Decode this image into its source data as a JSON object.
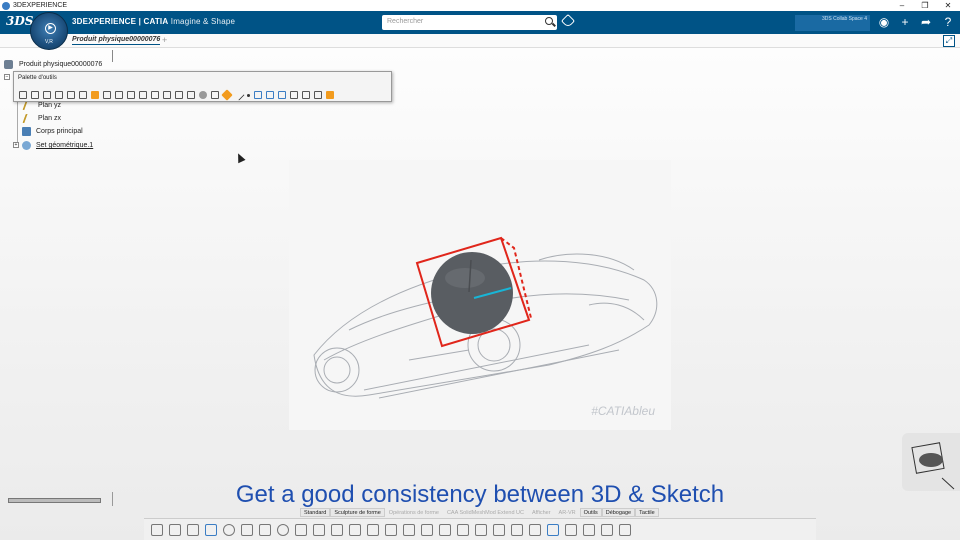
{
  "window": {
    "title": "3DEXPERIENCE",
    "controls": [
      "–",
      "❐",
      "✕"
    ]
  },
  "header": {
    "brand": "3DEXPERIENCE | CATIA",
    "app_name": "Imagine & Shape",
    "compass_version": "V,R",
    "search_placeholder": "Rechercher",
    "user_line1": "",
    "user_line2": "3DS Collab Space 4"
  },
  "tabs": {
    "active": "Produit physique00000076",
    "add": "+"
  },
  "tree": {
    "root": "Produit physique00000076",
    "items": [
      "Plan yz",
      "Plan zx",
      "Corps principal",
      "Set géométrique.1"
    ]
  },
  "palette": {
    "title": "Palette d'outils"
  },
  "viewport": {
    "watermark": "#CATIAbleu"
  },
  "caption": "Get a good consistency between 3D & Sketch",
  "section_tabs": [
    {
      "label": "Standard",
      "active": true
    },
    {
      "label": "Sculpture de forme",
      "active": true
    },
    {
      "label": "Opérations de forme",
      "active": false
    },
    {
      "label": "CAA SolidMeshMod Extend UC",
      "active": false
    },
    {
      "label": "Afficher",
      "active": false
    },
    {
      "label": "AR-VR",
      "active": false
    },
    {
      "label": "Outils",
      "active": true
    },
    {
      "label": "Débogage",
      "active": true
    },
    {
      "label": "Tactile",
      "active": true
    }
  ],
  "colors": {
    "header": "#005386",
    "caption": "#1f4fb0",
    "accent_orange": "#f29b1d",
    "red_box": "#e0261b"
  }
}
